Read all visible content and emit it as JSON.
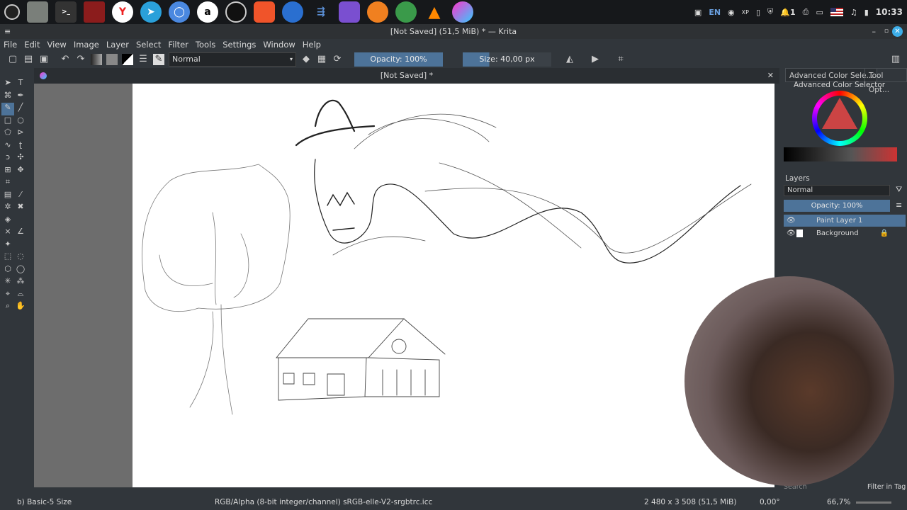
{
  "taskbar": {
    "apps": [
      "menu",
      "files",
      "terminal",
      "app",
      "yandex",
      "telegram",
      "chromium",
      "a",
      "obs",
      "brave",
      "thunderbird",
      "kdenlive",
      "obsidian",
      "firefox",
      "darktable",
      "vlc",
      "krita"
    ],
    "tray": {
      "lang": "EN",
      "notif_count": "1",
      "clock": "10:33"
    }
  },
  "window": {
    "title": "[Not Saved]  (51,5 MiB)  * — Krita"
  },
  "menu": [
    "File",
    "Edit",
    "View",
    "Image",
    "Layer",
    "Select",
    "Filter",
    "Tools",
    "Settings",
    "Window",
    "Help"
  ],
  "toolbar": {
    "blend_mode": "Normal",
    "opacity": "Opacity: 100%",
    "size": "Size: 40,00 px"
  },
  "document": {
    "tab_title": "[Not Saved]  *"
  },
  "docker": {
    "tabs": [
      "Advanced Color Sele...",
      "Tool Opt..."
    ],
    "color_selector_title": "Advanced Color Selector",
    "layers_title": "Layers",
    "layers_blend": "Normal",
    "layers_opacity": "Opacity:  100%",
    "layers": [
      {
        "name": "Paint Layer 1",
        "selected": true
      },
      {
        "name": "Background",
        "selected": false
      }
    ],
    "search_placeholder": "Search",
    "filter_tag": "Filter in Tag"
  },
  "status": {
    "brush": "b) Basic-5 Size",
    "colorspace": "RGB/Alpha (8-bit integer/channel)  sRGB-elle-V2-srgbtrc.icc",
    "dimensions": "2 480 x 3 508 (51,5 MiB)",
    "rotation": "0,00°",
    "zoom": "66,7%"
  },
  "colors": {
    "accent": "#4d7399",
    "canvas": "#ffffff",
    "bg": "#31363b"
  }
}
